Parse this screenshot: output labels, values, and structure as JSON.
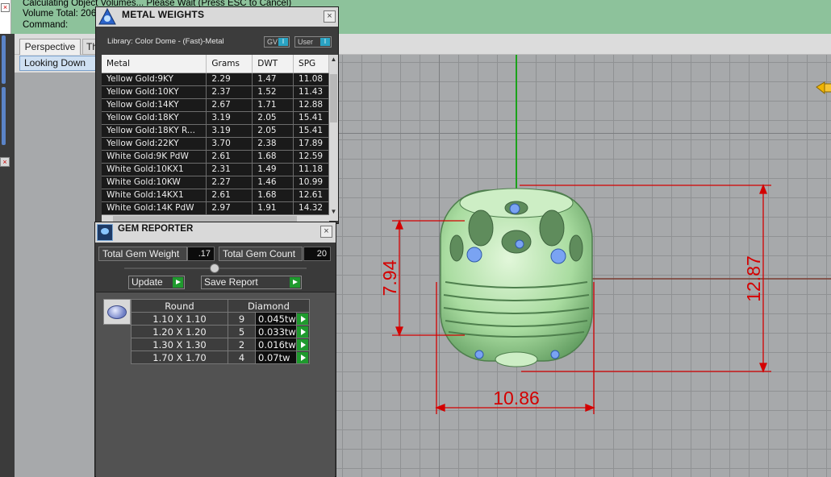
{
  "command_area": {
    "line1": "Calculating Object Volumes... Please Wait (Press ESC to Cancel)",
    "line2": "Volume Total: 206",
    "line3": "Command:"
  },
  "viewport": {
    "tabs": [
      "Perspective",
      "Th"
    ],
    "view_menu": "Looking Down",
    "dimensions": {
      "width": "10.86",
      "height_full": "12.87",
      "height_partial": "7.94"
    },
    "colors": {
      "background": "#a7a9ab",
      "grid": "#8f9193",
      "dimension": "#d40000",
      "model": "#b8e8b0"
    }
  },
  "metal_weights": {
    "title": "METAL WEIGHTS",
    "library": "Library: Color Dome - (Fast)-Metal",
    "toggle_gv": "GV",
    "toggle_user": "User",
    "columns": [
      "Metal",
      "Grams",
      "DWT",
      "SPG"
    ],
    "rows": [
      [
        "Yellow Gold:9KY",
        "2.29",
        "1.47",
        "11.08"
      ],
      [
        "Yellow Gold:10KY",
        "2.37",
        "1.52",
        "11.43"
      ],
      [
        "Yellow Gold:14KY",
        "2.67",
        "1.71",
        "12.88"
      ],
      [
        "Yellow Gold:18KY",
        "3.19",
        "2.05",
        "15.41"
      ],
      [
        "Yellow Gold:18KY R...",
        "3.19",
        "2.05",
        "15.41"
      ],
      [
        "Yellow Gold:22KY",
        "3.70",
        "2.38",
        "17.89"
      ],
      [
        "White Gold:9K PdW",
        "2.61",
        "1.68",
        "12.59"
      ],
      [
        "White Gold:10KX1",
        "2.31",
        "1.49",
        "11.18"
      ],
      [
        "White Gold:10KW",
        "2.27",
        "1.46",
        "10.99"
      ],
      [
        "White Gold:14KX1",
        "2.61",
        "1.68",
        "12.61"
      ],
      [
        "White Gold:14K PdW",
        "2.97",
        "1.91",
        "14.32"
      ]
    ]
  },
  "gem_reporter": {
    "title": "GEM REPORTER",
    "total_weight_label": "Total Gem Weight",
    "total_weight_value": ".17",
    "total_count_label": "Total Gem Count",
    "total_count_value": "20",
    "update_button": "Update",
    "save_report_button": "Save Report",
    "shape_header": "Round",
    "type_header": "Diamond",
    "rows": [
      {
        "size": "1.10 X 1.10",
        "count": "9",
        "weight": "0.045tw"
      },
      {
        "size": "1.20 X 1.20",
        "count": "5",
        "weight": "0.033tw"
      },
      {
        "size": "1.30 X 1.30",
        "count": "2",
        "weight": "0.016tw"
      },
      {
        "size": "1.70 X 1.70",
        "count": "4",
        "weight": "0.07tw"
      }
    ]
  }
}
